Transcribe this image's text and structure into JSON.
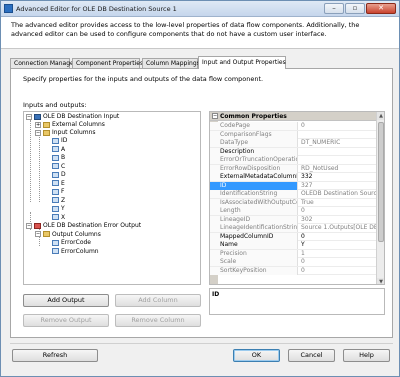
{
  "window": {
    "title": "Advanced Editor for OLE DB Destination Source 1",
    "description": "The advanced editor provides access to the low-level properties of data flow components. Additionally, the advanced editor can be used to configure components that do not have a custom user interface."
  },
  "tabs": [
    {
      "label": "Connection Managers",
      "active": false
    },
    {
      "label": "Component Properties",
      "active": false
    },
    {
      "label": "Column Mappings",
      "active": false
    },
    {
      "label": "Input and Output Properties",
      "active": true
    }
  ],
  "panel": {
    "intro": "Specify properties for the inputs and outputs of the data flow component.",
    "io_label": "Inputs and outputs:"
  },
  "tree": {
    "root_input": "OLE DB Destination Input",
    "external_columns": "External Columns",
    "input_columns": "Input Columns",
    "columns": [
      "ID",
      "A",
      "B",
      "C",
      "D",
      "E",
      "F",
      "Z",
      "Y",
      "X"
    ],
    "error_output": "OLE DB Destination Error Output",
    "output_columns": "Output Columns",
    "error_columns": [
      "ErrorCode",
      "ErrorColumn"
    ]
  },
  "properties": {
    "category": "Common Properties",
    "rows": [
      {
        "name": "CodePage",
        "value": "0",
        "editable": false
      },
      {
        "name": "ComparisonFlags",
        "value": "",
        "editable": false
      },
      {
        "name": "DataType",
        "value": "DT_NUMERIC",
        "editable": false
      },
      {
        "name": "Description",
        "value": "",
        "editable": true
      },
      {
        "name": "ErrorOrTruncationOperation",
        "value": "",
        "editable": false
      },
      {
        "name": "ErrorRowDisposition",
        "value": "RD_NotUsed",
        "editable": false
      },
      {
        "name": "ExternalMetadataColumnID",
        "value": "332",
        "editable": true
      },
      {
        "name": "ID",
        "value": "327",
        "editable": false,
        "selected": true
      },
      {
        "name": "IdentificationString",
        "value": "OLEDB Destination Source 1.",
        "editable": false
      },
      {
        "name": "IsAssociatedWithOutputColumn",
        "value": "True",
        "editable": false
      },
      {
        "name": "Length",
        "value": "0",
        "editable": false
      },
      {
        "name": "LineageID",
        "value": "302",
        "editable": false
      },
      {
        "name": "LineageIdentificationString",
        "value": "Source 1.Outputs[OLE DB So",
        "editable": false
      },
      {
        "name": "MappedColumnID",
        "value": "0",
        "editable": true
      },
      {
        "name": "Name",
        "value": "Y",
        "editable": true
      },
      {
        "name": "Precision",
        "value": "1",
        "editable": false
      },
      {
        "name": "Scale",
        "value": "0",
        "editable": false
      },
      {
        "name": "SortKeyPosition",
        "value": "0",
        "editable": false
      }
    ],
    "description_title": "ID"
  },
  "buttons": {
    "add_output": "Add Output",
    "add_column": "Add Column",
    "remove_output": "Remove Output",
    "remove_column": "Remove Column",
    "refresh": "Refresh",
    "ok": "OK",
    "cancel": "Cancel",
    "help": "Help"
  },
  "colors": {
    "selection": "#3399ff",
    "title_gradient_top": "#dfe9f5",
    "category_bg": "#d4d0c8"
  },
  "icons": [
    "destination-icon",
    "folder-icon",
    "column-icon",
    "error-output-icon",
    "minimize-icon",
    "maximize-icon",
    "close-icon"
  ]
}
